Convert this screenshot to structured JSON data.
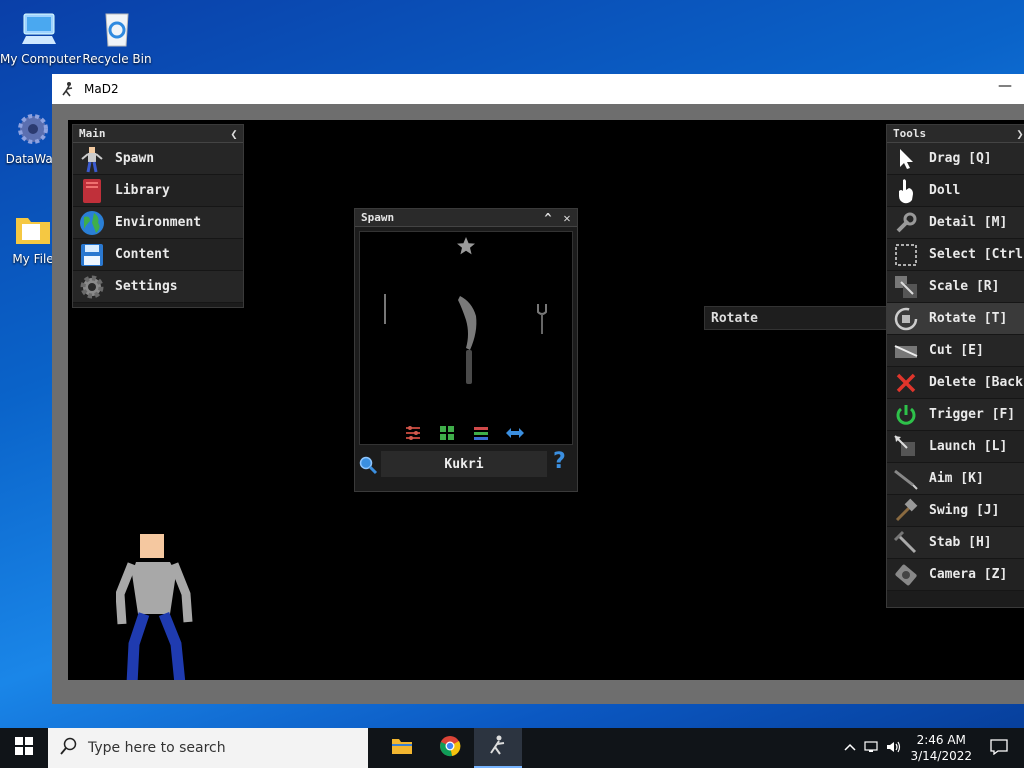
{
  "desktop": {
    "icons": [
      {
        "label": "My Computer"
      },
      {
        "label": "Recycle Bin"
      },
      {
        "label": "DataWag"
      },
      {
        "label": "My File"
      }
    ]
  },
  "window": {
    "title": "MaD2",
    "minimize_glyph": "—"
  },
  "main_panel": {
    "title": "Main",
    "collapse_glyph": "❮",
    "items": [
      {
        "label": "Spawn",
        "icon": "person-icon"
      },
      {
        "label": "Library",
        "icon": "book-icon"
      },
      {
        "label": "Environment",
        "icon": "globe-icon"
      },
      {
        "label": "Content",
        "icon": "floppy-icon"
      },
      {
        "label": "Settings",
        "icon": "gear-icon"
      }
    ]
  },
  "spawn_panel": {
    "title": "Spawn",
    "collapse_glyph": "^",
    "close_glyph": "✕",
    "search_value": "Kukri",
    "help_glyph": "?"
  },
  "tooltip": {
    "text": "Rotate"
  },
  "tools_panel": {
    "title": "Tools",
    "items": [
      {
        "label": "Drag [Q]",
        "icon": "cursor-arrow-icon"
      },
      {
        "label": "Doll",
        "icon": "hand-icon"
      },
      {
        "label": "Detail [M]",
        "icon": "wrench-icon"
      },
      {
        "label": "Select [Ctrl",
        "icon": "select-box-icon"
      },
      {
        "label": "Scale [R]",
        "icon": "scale-icon"
      },
      {
        "label": "Rotate [T]",
        "icon": "rotate-icon"
      },
      {
        "label": "Cut [E]",
        "icon": "cut-icon"
      },
      {
        "label": "Delete [Back",
        "icon": "delete-x-icon"
      },
      {
        "label": "Trigger [F]",
        "icon": "power-icon"
      },
      {
        "label": "Launch [L]",
        "icon": "launch-icon"
      },
      {
        "label": "Aim [K]",
        "icon": "aim-icon"
      },
      {
        "label": "Swing [J]",
        "icon": "hammer-icon"
      },
      {
        "label": "Stab [H]",
        "icon": "sword-icon"
      },
      {
        "label": "Camera [Z]",
        "icon": "camera-icon"
      }
    ]
  },
  "taskbar": {
    "search_placeholder": "Type here to search",
    "time": "2:46 AM",
    "date": "3/14/2022"
  },
  "colors": {
    "accent_blue": "#3b8fe0",
    "delete_red": "#e0352b",
    "trigger_green": "#2ec24a",
    "panel_bg": "#1c1c1c"
  }
}
